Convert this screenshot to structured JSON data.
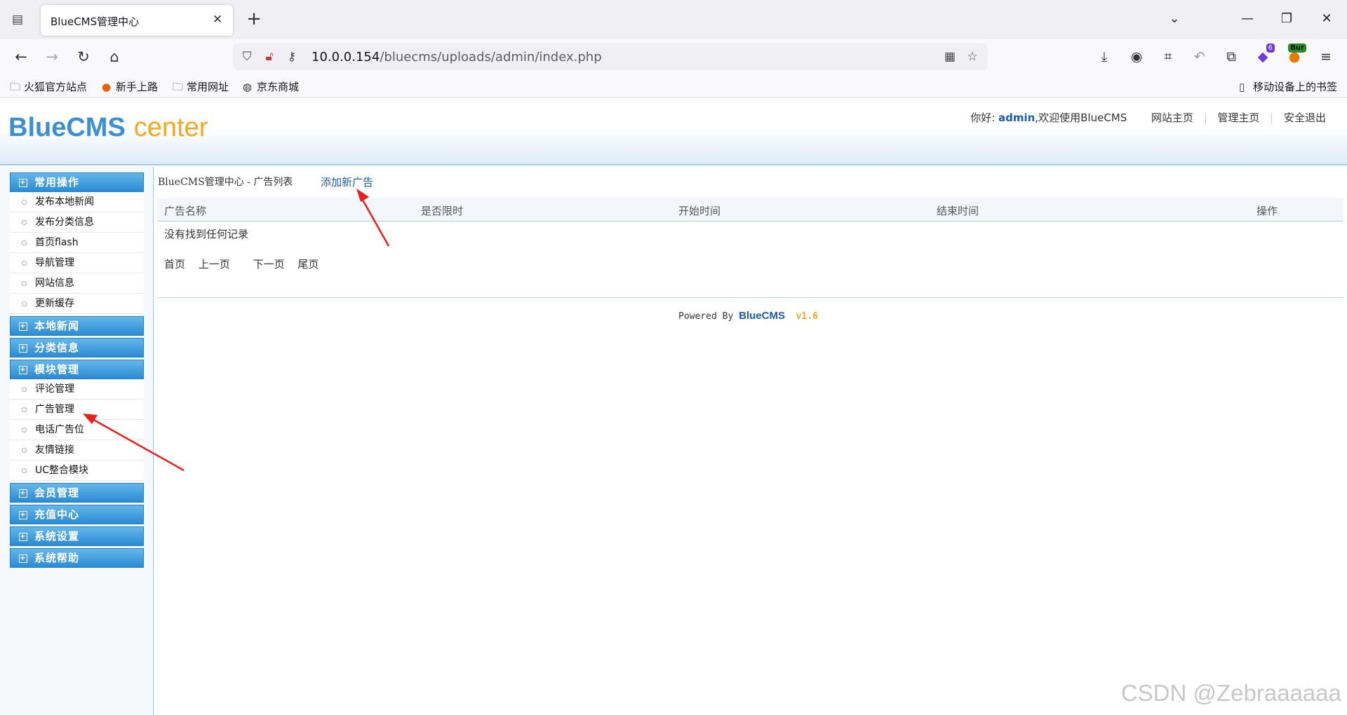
{
  "browser": {
    "tab_title": "BlueCMS管理中心",
    "url_host": "10.0.0.154",
    "url_path": "/bluecms/uploads/admin/index.php",
    "extension_badge": "6",
    "burp_label": "Bur",
    "bookmarks": [
      "火狐官方站点",
      "新手上路",
      "常用网址",
      "京东商城"
    ],
    "mobile_bookmarks": "移动设备上的书签"
  },
  "header": {
    "logo_main": "BlueCMS",
    "logo_sub": "center",
    "greeting": "你好:",
    "username": "admin",
    "welcome": ",欢迎使用BlueCMS",
    "links": [
      "网站主页",
      "管理主页",
      "安全退出"
    ]
  },
  "sidebar": {
    "groups": [
      {
        "label": "常用操作",
        "items": [
          "发布本地新闻",
          "发布分类信息",
          "首页flash",
          "导航管理",
          "网站信息",
          "更新缓存"
        ]
      },
      {
        "label": "本地新闻",
        "items": []
      },
      {
        "label": "分类信息",
        "items": []
      },
      {
        "label": "模块管理",
        "items": [
          "评论管理",
          "广告管理",
          "电话广告位",
          "友情链接",
          "UC整合模块"
        ]
      },
      {
        "label": "会员管理",
        "items": []
      },
      {
        "label": "充值中心",
        "items": []
      },
      {
        "label": "系统设置",
        "items": []
      },
      {
        "label": "系统帮助",
        "items": []
      }
    ]
  },
  "main": {
    "breadcrumb": "BlueCMS管理中心 - 广告列表",
    "add_link": "添加新广告",
    "columns": [
      "广告名称",
      "是否限时",
      "开始时间",
      "结束时间",
      "操作"
    ],
    "empty_text": "没有找到任何记录",
    "pager": [
      "首页",
      "上一页",
      "下一页",
      "尾页"
    ],
    "powered_prefix": "Powered By",
    "powered_brand": "BlueCMS",
    "powered_version": "v1.6"
  },
  "watermark": "CSDN @Zebraaaaaa",
  "colors": {
    "accent_blue": "#2b8bd3",
    "link_blue": "#1e5da8",
    "logo_orange": "#f5a623",
    "annotation_red": "#e8201b"
  }
}
